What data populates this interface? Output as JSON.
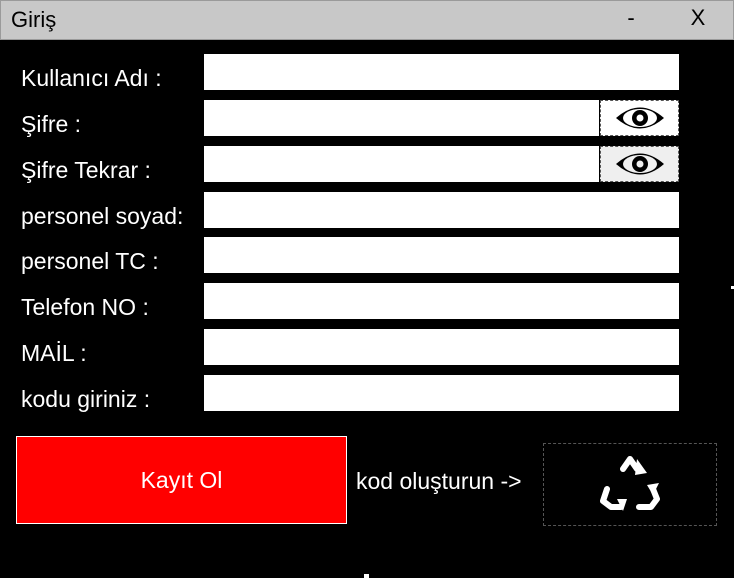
{
  "window": {
    "title": "Giriş",
    "minimize_label": "-",
    "close_label": "X"
  },
  "form": {
    "fields": [
      {
        "label": "Kullanıcı Adı :",
        "value": ""
      },
      {
        "label": "Şifre :",
        "value": ""
      },
      {
        "label": "Şifre Tekrar :",
        "value": ""
      },
      {
        "label": "personel soyad:",
        "value": ""
      },
      {
        "label": "personel TC :",
        "value": ""
      },
      {
        "label": "Telefon NO :",
        "value": ""
      },
      {
        "label": "MAİL :",
        "value": ""
      },
      {
        "label": "kodu giriniz :",
        "value": ""
      }
    ]
  },
  "actions": {
    "register_label": "Kayıt Ol",
    "generate_code_label": "kod oluşturun ->",
    "generate_code_icon": "recycle-icon"
  },
  "icons": {
    "password_toggle": "eye-icon"
  },
  "colors": {
    "background": "#000000",
    "titlebar": "#c8c8c8",
    "register_button": "#ff0000",
    "text": "#ffffff"
  }
}
